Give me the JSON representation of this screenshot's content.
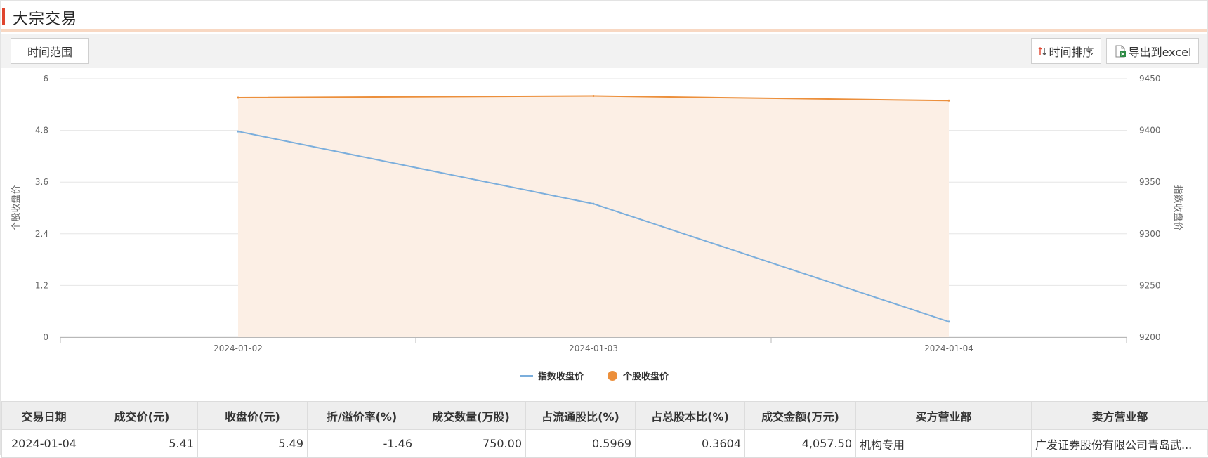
{
  "page": {
    "title": "大宗交易"
  },
  "toolbar": {
    "time_range_label": "时间范围",
    "sort_label": "时间排序",
    "export_label": "导出到excel",
    "sort_icon": "sort-arrows-icon",
    "export_icon": "excel-export-icon"
  },
  "colors": {
    "accent": "#e0452e",
    "index_line": "#7baedc",
    "stock_line": "#ec8f3b",
    "area_fill": "#fcefe5"
  },
  "chart_data": {
    "type": "line",
    "x": [
      "2024-01-02",
      "2024-01-03",
      "2024-01-04"
    ],
    "series": [
      {
        "name": "指数收盘价",
        "axis": "right",
        "values": [
          9399,
          9329,
          9215
        ]
      },
      {
        "name": "个股收盘价",
        "axis": "left",
        "values": [
          5.56,
          5.6,
          5.49
        ],
        "area": true
      }
    ],
    "ylabel": "个股收盘价",
    "ylabel_right": "指数收盘价",
    "yticks_left": [
      "0",
      "1.2",
      "2.4",
      "3.6",
      "4.8",
      "6"
    ],
    "yticks_right": [
      "9200",
      "9250",
      "9300",
      "9350",
      "9400",
      "9450"
    ],
    "ylim_left": [
      0,
      6
    ],
    "ylim_right": [
      9200,
      9450
    ],
    "grid": true,
    "legend": "bottom"
  },
  "table": {
    "columns": [
      "交易日期",
      "成交价(元)",
      "收盘价(元)",
      "折/溢价率(%)",
      "成交数量(万股)",
      "占流通股比(%)",
      "占总股本比(%)",
      "成交金额(万元)",
      "买方营业部",
      "卖方营业部"
    ],
    "rows": [
      [
        "2024-01-04",
        "5.41",
        "5.49",
        "-1.46",
        "750.00",
        "0.5969",
        "0.3604",
        "4,057.50",
        "机构专用",
        "广发证券股份有限公司青岛武..."
      ]
    ]
  }
}
